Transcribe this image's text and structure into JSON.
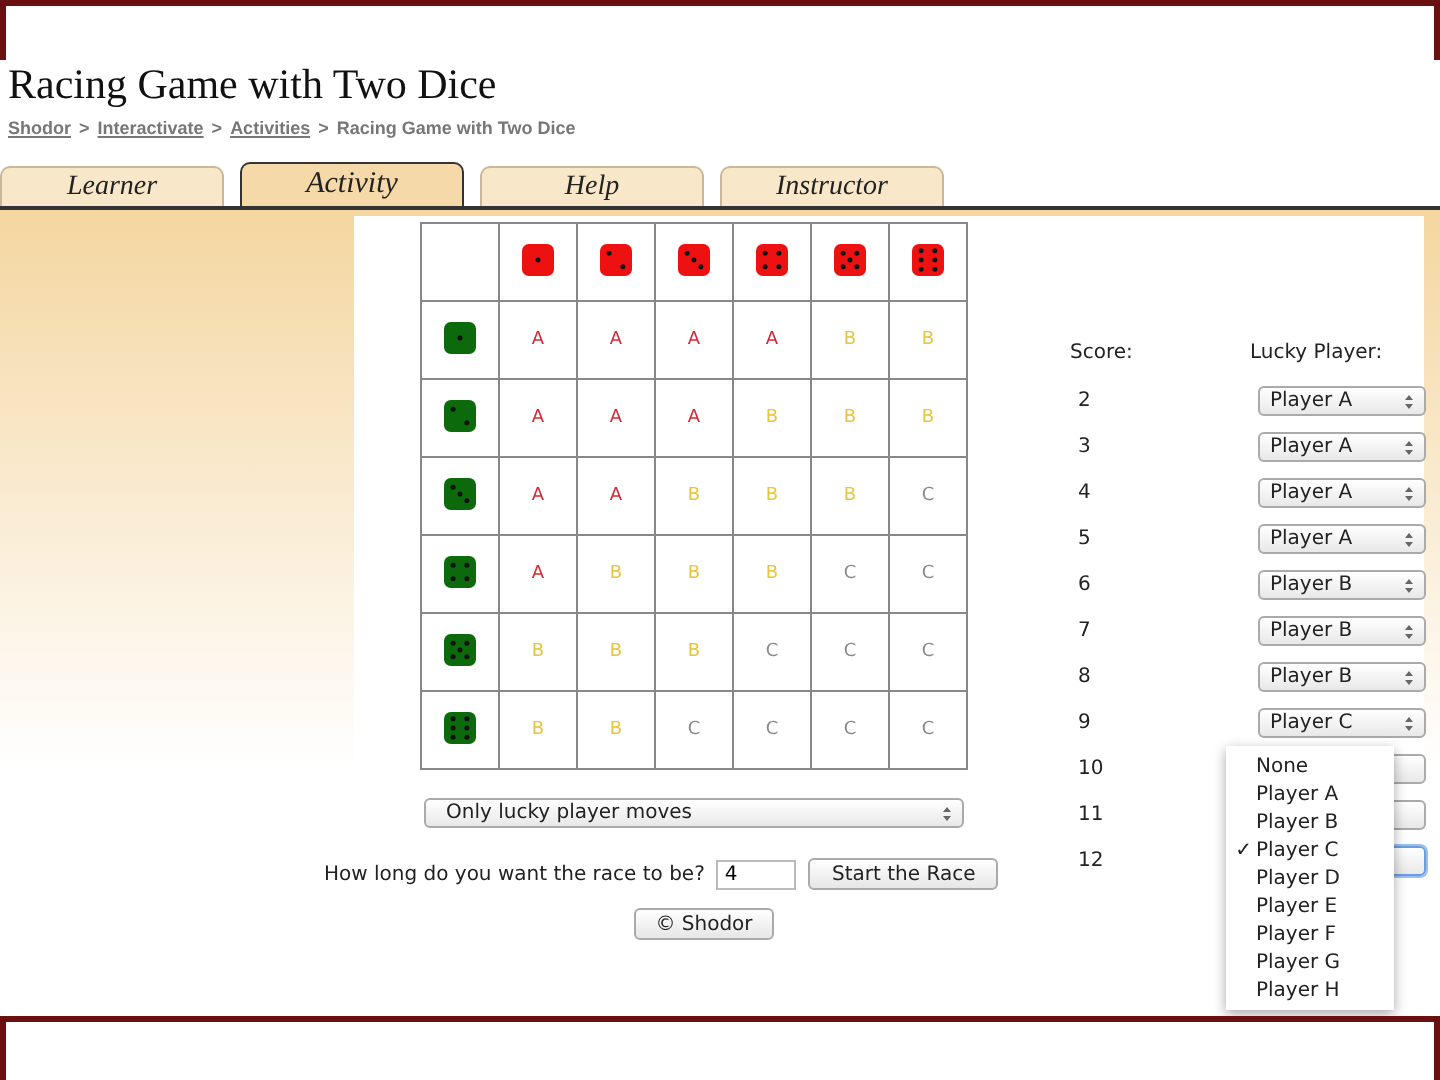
{
  "title": "Racing Game with Two Dice",
  "breadcrumb": [
    {
      "label": "Shodor",
      "link": true
    },
    {
      "label": "Interactivate",
      "link": true
    },
    {
      "label": "Activities",
      "link": true
    },
    {
      "label": "Racing Game with Two Dice",
      "link": false
    }
  ],
  "breadcrumb_separator": ">",
  "tabs": [
    {
      "label": "Learner",
      "selected": false
    },
    {
      "label": "Activity",
      "selected": true
    },
    {
      "label": "Help",
      "selected": false
    },
    {
      "label": "Instructor",
      "selected": false
    }
  ],
  "grid_rows": [
    {
      "cells": [
        {
          "text": "A",
          "color": "#d42a35"
        },
        {
          "text": "A",
          "color": "#d42a35"
        },
        {
          "text": "A",
          "color": "#d42a35"
        },
        {
          "text": "A",
          "color": "#d42a35"
        },
        {
          "text": "B",
          "color": "#e8c43a"
        },
        {
          "text": "B",
          "color": "#e8c43a"
        }
      ]
    },
    {
      "cells": [
        {
          "text": "A",
          "color": "#d42a35"
        },
        {
          "text": "A",
          "color": "#d42a35"
        },
        {
          "text": "A",
          "color": "#d42a35"
        },
        {
          "text": "B",
          "color": "#e8c43a"
        },
        {
          "text": "B",
          "color": "#e8c43a"
        },
        {
          "text": "B",
          "color": "#e8c43a"
        }
      ]
    },
    {
      "cells": [
        {
          "text": "A",
          "color": "#d42a35"
        },
        {
          "text": "A",
          "color": "#d42a35"
        },
        {
          "text": "B",
          "color": "#e8c43a"
        },
        {
          "text": "B",
          "color": "#e8c43a"
        },
        {
          "text": "B",
          "color": "#e8c43a"
        },
        {
          "text": "C",
          "color": "#8a8a8a"
        }
      ]
    },
    {
      "cells": [
        {
          "text": "A",
          "color": "#d42a35"
        },
        {
          "text": "B",
          "color": "#e8c43a"
        },
        {
          "text": "B",
          "color": "#e8c43a"
        },
        {
          "text": "B",
          "color": "#e8c43a"
        },
        {
          "text": "C",
          "color": "#8a8a8a"
        },
        {
          "text": "C",
          "color": "#8a8a8a"
        }
      ]
    },
    {
      "cells": [
        {
          "text": "B",
          "color": "#e8c43a"
        },
        {
          "text": "B",
          "color": "#e8c43a"
        },
        {
          "text": "B",
          "color": "#e8c43a"
        },
        {
          "text": "C",
          "color": "#8a8a8a"
        },
        {
          "text": "C",
          "color": "#8a8a8a"
        },
        {
          "text": "C",
          "color": "#8a8a8a"
        }
      ]
    },
    {
      "cells": [
        {
          "text": "B",
          "color": "#e8c43a"
        },
        {
          "text": "B",
          "color": "#e8c43a"
        },
        {
          "text": "C",
          "color": "#8a8a8a"
        },
        {
          "text": "C",
          "color": "#8a8a8a"
        },
        {
          "text": "C",
          "color": "#8a8a8a"
        },
        {
          "text": "C",
          "color": "#8a8a8a"
        }
      ]
    }
  ],
  "score_header": "Score:",
  "lucky_header": "Lucky Player:",
  "scores": [
    {
      "score": "2",
      "lucky": "Player A"
    },
    {
      "score": "3",
      "lucky": "Player A"
    },
    {
      "score": "4",
      "lucky": "Player A"
    },
    {
      "score": "5",
      "lucky": "Player A"
    },
    {
      "score": "6",
      "lucky": "Player B"
    },
    {
      "score": "7",
      "lucky": "Player B"
    },
    {
      "score": "8",
      "lucky": "Player B"
    },
    {
      "score": "9",
      "lucky": "Player C"
    },
    {
      "score": "10"
    },
    {
      "score": "11"
    },
    {
      "score": "12",
      "open": true
    }
  ],
  "open_menu": [
    {
      "label": "None",
      "selected": false
    },
    {
      "label": "Player A",
      "selected": false
    },
    {
      "label": "Player B",
      "selected": false
    },
    {
      "label": "Player C",
      "selected": true
    },
    {
      "label": "Player D",
      "selected": false
    },
    {
      "label": "Player E",
      "selected": false
    },
    {
      "label": "Player F",
      "selected": false
    },
    {
      "label": "Player G",
      "selected": false
    },
    {
      "label": "Player H",
      "selected": false
    }
  ],
  "check_mark": "✓",
  "mode_select": "Only lucky player moves",
  "race_prompt": "How long do you want the race to be?",
  "race_length": "4",
  "start_button": "Start the Race",
  "footer_button": "© Shodor"
}
